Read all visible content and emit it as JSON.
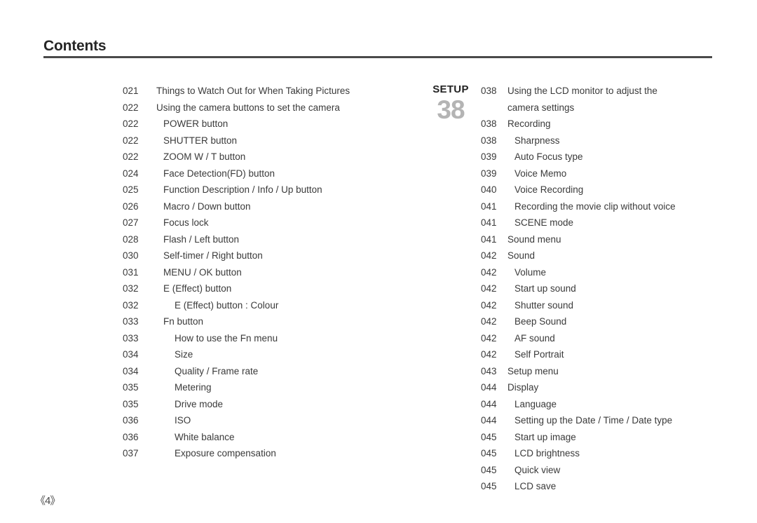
{
  "header": {
    "title": "Contents"
  },
  "setup_badge": {
    "word": "SETUP",
    "number": "38"
  },
  "footer": {
    "page_marker": "《4》"
  },
  "left_column": {
    "entries": [
      {
        "page": "021",
        "label": "Things to Watch Out for When Taking Pictures",
        "level": 0
      },
      {
        "page": "022",
        "label": "Using the camera buttons to set the camera",
        "level": 0
      },
      {
        "page": "022",
        "label": "POWER button",
        "level": 1
      },
      {
        "page": "022",
        "label": "SHUTTER button",
        "level": 1
      },
      {
        "page": "022",
        "label": "ZOOM W / T button",
        "level": 1
      },
      {
        "page": "024",
        "label": "Face Detection(FD) button",
        "level": 1
      },
      {
        "page": "025",
        "label": "Function Description / Info / Up button",
        "level": 1
      },
      {
        "page": "026",
        "label": "Macro / Down button",
        "level": 1
      },
      {
        "page": "027",
        "label": "Focus lock",
        "level": 1
      },
      {
        "page": "028",
        "label": "Flash / Left button",
        "level": 1
      },
      {
        "page": "030",
        "label": "Self-timer / Right button",
        "level": 1
      },
      {
        "page": "031",
        "label": "MENU / OK button",
        "level": 1
      },
      {
        "page": "032",
        "label": "E (Effect) button",
        "level": 1
      },
      {
        "page": "032",
        "label": "E (Effect) button : Colour",
        "level": 2
      },
      {
        "page": "033",
        "label": "Fn button",
        "level": 1
      },
      {
        "page": "033",
        "label": "How to use the Fn menu",
        "level": 2
      },
      {
        "page": "034",
        "label": "Size",
        "level": 2
      },
      {
        "page": "034",
        "label": "Quality / Frame rate",
        "level": 2
      },
      {
        "page": "035",
        "label": "Metering",
        "level": 2
      },
      {
        "page": "035",
        "label": "Drive mode",
        "level": 2
      },
      {
        "page": "036",
        "label": "ISO",
        "level": 2
      },
      {
        "page": "036",
        "label": "White balance",
        "level": 2
      },
      {
        "page": "037",
        "label": "Exposure compensation",
        "level": 2
      }
    ]
  },
  "right_column": {
    "entries": [
      {
        "page": "038",
        "label": "Using the LCD monitor to adjust the",
        "level": 0
      },
      {
        "page": "",
        "label": "camera settings",
        "level": 0,
        "continuation": true
      },
      {
        "page": "038",
        "label": "Recording",
        "level": 0
      },
      {
        "page": "038",
        "label": "Sharpness",
        "level": 1
      },
      {
        "page": "039",
        "label": "Auto Focus type",
        "level": 1
      },
      {
        "page": "039",
        "label": "Voice Memo",
        "level": 1
      },
      {
        "page": "040",
        "label": "Voice Recording",
        "level": 1
      },
      {
        "page": "041",
        "label": "Recording the movie clip without voice",
        "level": 1
      },
      {
        "page": "041",
        "label": "SCENE mode",
        "level": 1
      },
      {
        "page": "041",
        "label": "Sound menu",
        "level": 0
      },
      {
        "page": "042",
        "label": "Sound",
        "level": 0
      },
      {
        "page": "042",
        "label": "Volume",
        "level": 1
      },
      {
        "page": "042",
        "label": "Start up sound",
        "level": 1
      },
      {
        "page": "042",
        "label": "Shutter sound",
        "level": 1
      },
      {
        "page": "042",
        "label": "Beep Sound",
        "level": 1
      },
      {
        "page": "042",
        "label": "AF sound",
        "level": 1
      },
      {
        "page": "042",
        "label": "Self Portrait",
        "level": 1
      },
      {
        "page": "043",
        "label": "Setup menu",
        "level": 0
      },
      {
        "page": "044",
        "label": "Display",
        "level": 0
      },
      {
        "page": "044",
        "label": "Language",
        "level": 1
      },
      {
        "page": "044",
        "label": "Setting up the Date / Time / Date type",
        "level": 1
      },
      {
        "page": "045",
        "label": "Start up image",
        "level": 1
      },
      {
        "page": "045",
        "label": "LCD brightness",
        "level": 1
      },
      {
        "page": "045",
        "label": "Quick view",
        "level": 1
      },
      {
        "page": "045",
        "label": "LCD save",
        "level": 1
      }
    ]
  }
}
